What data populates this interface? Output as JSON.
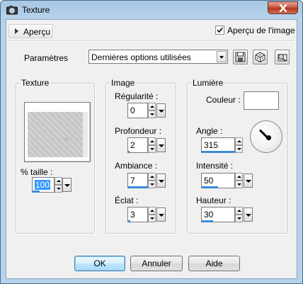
{
  "window": {
    "title": "Texture"
  },
  "header": {
    "preview_toggle_label": "Aperçu",
    "preview_checkbox_label": "Aperçu de l'image",
    "preview_checked": true
  },
  "presets": {
    "label": "Paramètres",
    "selected": "Dernières options utilisées"
  },
  "texture_group": {
    "title": "Texture",
    "size_label": "% taille :",
    "size_value": "100"
  },
  "image_group": {
    "title": "Image",
    "fields": [
      {
        "label": "Régularité :",
        "value": "0"
      },
      {
        "label": "Profondeur :",
        "value": "2"
      },
      {
        "label": "Ambiance :",
        "value": "7"
      },
      {
        "label": "Éclat :",
        "value": "3"
      }
    ]
  },
  "light_group": {
    "title": "Lumière",
    "color_label": "Couleur :",
    "color_value": "#ffffff",
    "fields": [
      {
        "label": "Angle :",
        "value": "315"
      },
      {
        "label": "Intensité :",
        "value": "50"
      },
      {
        "label": "Hauteur :",
        "value": "30"
      }
    ]
  },
  "buttons": {
    "ok": "OK",
    "cancel": "Annuler",
    "help": "Aide"
  }
}
